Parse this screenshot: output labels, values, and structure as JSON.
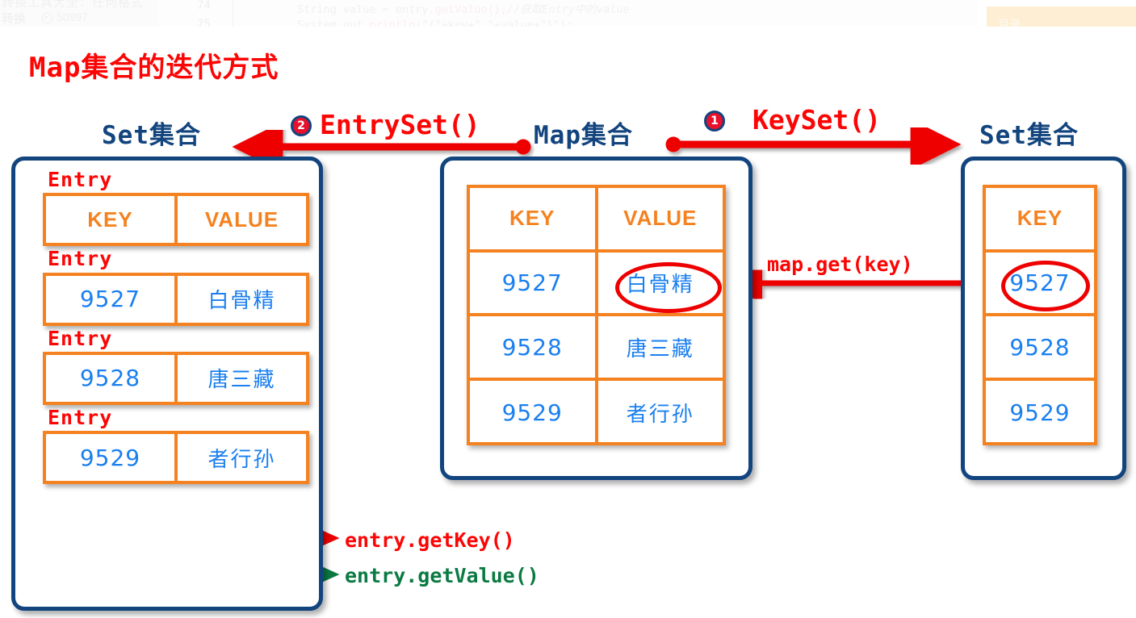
{
  "editor_strip": {
    "left_pane_line1": "转换工具大全：任何格式",
    "left_pane_line2": "转换",
    "view_count": "50997",
    "eye_icon": "eye-icon",
    "lines": [
      {
        "number": "74",
        "code_plain": "String value = entry.",
        "code_method": "getValue();",
        "code_comment": "//获取Entry中的value"
      },
      {
        "number": "75",
        "code_plain": "System.out.",
        "code_method": "println(",
        "code_comment": "\"{\"+key+\" \"+value+\"}\");"
      }
    ],
    "toc_label": "目录"
  },
  "page_title": "Map集合的迭代方式",
  "header": {
    "set_left_label": "Set集合",
    "map_label": "Map集合",
    "set_right_label": "Set集合",
    "entryset_method": "EntrySet()",
    "keyset_method": "KeySet()",
    "badge_entryset": "2",
    "badge_keyset": "1"
  },
  "entryset_panel": {
    "entries": [
      {
        "caption": "Entry",
        "key": "KEY",
        "value": "VALUE",
        "is_header": true
      },
      {
        "caption": "Entry",
        "key": "9527",
        "value": "白骨精",
        "is_header": false
      },
      {
        "caption": "Entry",
        "key": "9528",
        "value": "唐三藏",
        "is_header": false
      },
      {
        "caption": "Entry",
        "key": "9529",
        "value": "者行孙",
        "is_header": false
      }
    ]
  },
  "map_panel": {
    "columns": [
      "KEY",
      "VALUE"
    ],
    "rows": [
      {
        "key": "9527",
        "value": "白骨精",
        "value_highlighted": true
      },
      {
        "key": "9528",
        "value": "唐三藏",
        "value_highlighted": false
      },
      {
        "key": "9529",
        "value": "者行孙",
        "value_highlighted": false
      }
    ]
  },
  "keyset_panel": {
    "column": "KEY",
    "rows": [
      {
        "key": "9527",
        "highlighted": true
      },
      {
        "key": "9528",
        "highlighted": false
      },
      {
        "key": "9529",
        "highlighted": false
      }
    ]
  },
  "annotations": {
    "map_get": "map.get(key)",
    "entry_get_key": "entry.getKey()",
    "entry_get_value": "entry.getValue()"
  },
  "colors": {
    "title_red": "#fc0505",
    "panel_navy": "#12447e",
    "table_orange": "#f58220",
    "value_blue": "#1a7ff0",
    "highlight_red": "#ee0000",
    "green": "#0a7a42",
    "badge_red": "#e8112d",
    "toc_bg": "#fdeed4"
  }
}
